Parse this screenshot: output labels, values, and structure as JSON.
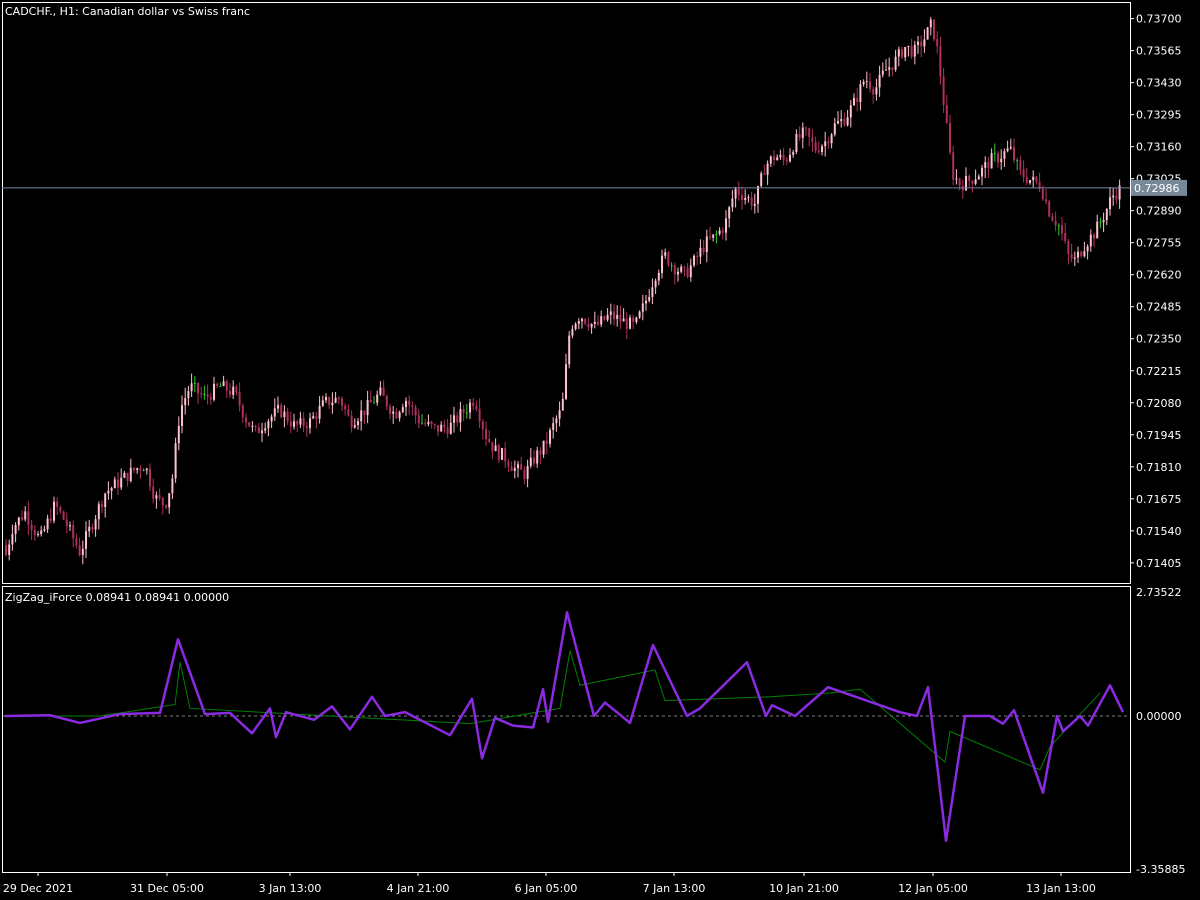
{
  "price_pane": {
    "title": "CADCHF., H1:  Canadian dollar vs Swiss franc",
    "y_ticks": [
      "0.73700",
      "0.73565",
      "0.73430",
      "0.73295",
      "0.73160",
      "0.73025",
      "0.72890",
      "0.72755",
      "0.72620",
      "0.72485",
      "0.72350",
      "0.72215",
      "0.72080",
      "0.71945",
      "0.71810",
      "0.71675",
      "0.71540",
      "0.71405"
    ],
    "current_price": "0.72986"
  },
  "indicator_pane": {
    "title": "ZigZag_iForce 0.08941 0.08941 0.00000",
    "y_ticks": [
      "2.73522",
      "0.00000",
      "-3.35885"
    ]
  },
  "x_ticks": [
    "29 Dec 2021",
    "31 Dec 05:00",
    "3 Jan 13:00",
    "4 Jan 21:00",
    "6 Jan 05:00",
    "7 Jan 13:00",
    "10 Jan 21:00",
    "12 Jan 05:00",
    "13 Jan 13:00"
  ],
  "colors": {
    "background": "#000000",
    "frame": "#ffffff",
    "bull_candle": "#ffc0cb",
    "bear_candle": "#b03060",
    "neutral_candle": "#32cd32",
    "zigzag": "#8a2be2",
    "force_line": "#008000",
    "zero_line": "#808080",
    "price_line": "#778899",
    "price_tag_bg": "#778899"
  },
  "chart_data": [
    {
      "type": "candlestick",
      "title": "CADCHF., H1:  Canadian dollar vs Swiss franc",
      "timeframe": "H1",
      "ylim": [
        0.7132,
        0.7377
      ],
      "close_path": [
        [
          0,
          0.7148
        ],
        [
          5,
          0.7142
        ],
        [
          12,
          0.7155
        ],
        [
          25,
          0.7162
        ],
        [
          40,
          0.715
        ],
        [
          55,
          0.7165
        ],
        [
          65,
          0.7158
        ],
        [
          80,
          0.7145
        ],
        [
          95,
          0.716
        ],
        [
          105,
          0.717
        ],
        [
          120,
          0.7175
        ],
        [
          135,
          0.718
        ],
        [
          145,
          0.7182
        ],
        [
          155,
          0.7168
        ],
        [
          165,
          0.7165
        ],
        [
          172,
          0.7175
        ],
        [
          180,
          0.7205
        ],
        [
          190,
          0.7215
        ],
        [
          205,
          0.721
        ],
        [
          220,
          0.7215
        ],
        [
          235,
          0.7212
        ],
        [
          245,
          0.7202
        ],
        [
          255,
          0.7195
        ],
        [
          265,
          0.72
        ],
        [
          280,
          0.7205
        ],
        [
          295,
          0.7198
        ],
        [
          310,
          0.72
        ],
        [
          325,
          0.7208
        ],
        [
          340,
          0.721
        ],
        [
          350,
          0.72
        ],
        [
          365,
          0.7205
        ],
        [
          380,
          0.7212
        ],
        [
          395,
          0.7203
        ],
        [
          405,
          0.721
        ],
        [
          420,
          0.72
        ],
        [
          435,
          0.7197
        ],
        [
          450,
          0.7198
        ],
        [
          465,
          0.7205
        ],
        [
          475,
          0.721
        ],
        [
          485,
          0.7195
        ],
        [
          495,
          0.7188
        ],
        [
          505,
          0.7185
        ],
        [
          515,
          0.718
        ],
        [
          525,
          0.7178
        ],
        [
          535,
          0.7185
        ],
        [
          545,
          0.719
        ],
        [
          555,
          0.72
        ],
        [
          562,
          0.7205
        ],
        [
          570,
          0.724
        ],
        [
          580,
          0.7245
        ],
        [
          595,
          0.724
        ],
        [
          610,
          0.7245
        ],
        [
          625,
          0.7242
        ],
        [
          635,
          0.724
        ],
        [
          645,
          0.725
        ],
        [
          655,
          0.7262
        ],
        [
          665,
          0.727
        ],
        [
          675,
          0.7265
        ],
        [
          685,
          0.7262
        ],
        [
          695,
          0.7268
        ],
        [
          705,
          0.7275
        ],
        [
          715,
          0.7278
        ],
        [
          725,
          0.7283
        ],
        [
          735,
          0.7298
        ],
        [
          745,
          0.7295
        ],
        [
          755,
          0.7292
        ],
        [
          765,
          0.7308
        ],
        [
          775,
          0.7312
        ],
        [
          785,
          0.731
        ],
        [
          795,
          0.7318
        ],
        [
          805,
          0.7322
        ],
        [
          815,
          0.7315
        ],
        [
          825,
          0.7318
        ],
        [
          835,
          0.7325
        ],
        [
          845,
          0.7328
        ],
        [
          855,
          0.7335
        ],
        [
          865,
          0.7345
        ],
        [
          875,
          0.734
        ],
        [
          885,
          0.7348
        ],
        [
          895,
          0.7352
        ],
        [
          905,
          0.7358
        ],
        [
          915,
          0.7356
        ],
        [
          925,
          0.7362
        ],
        [
          932,
          0.7368
        ],
        [
          938,
          0.7355
        ],
        [
          945,
          0.733
        ],
        [
          952,
          0.7305
        ],
        [
          960,
          0.73
        ],
        [
          970,
          0.7302
        ],
        [
          980,
          0.7305
        ],
        [
          990,
          0.731
        ],
        [
          1000,
          0.7312
        ],
        [
          1010,
          0.7315
        ],
        [
          1020,
          0.7305
        ],
        [
          1030,
          0.7302
        ],
        [
          1040,
          0.73
        ],
        [
          1050,
          0.7288
        ],
        [
          1060,
          0.7282
        ],
        [
          1068,
          0.727
        ],
        [
          1075,
          0.7268
        ],
        [
          1085,
          0.7275
        ],
        [
          1095,
          0.728
        ],
        [
          1105,
          0.7288
        ],
        [
          1112,
          0.7295
        ],
        [
          1120,
          0.7298
        ]
      ]
    },
    {
      "type": "line",
      "title": "ZigZag_iForce 0.08941 0.08941 0.00000",
      "ylim": [
        -3.35885,
        2.73522
      ],
      "series": [
        {
          "name": "ZigZag",
          "points": [
            [
              5,
              0.0
            ],
            [
              50,
              0.02
            ],
            [
              80,
              -0.18
            ],
            [
              120,
              0.05
            ],
            [
              160,
              0.08
            ],
            [
              178,
              2.0
            ],
            [
              205,
              0.05
            ],
            [
              230,
              0.08
            ],
            [
              252,
              -0.45
            ],
            [
              270,
              0.2
            ],
            [
              276,
              -0.55
            ],
            [
              286,
              0.1
            ],
            [
              314,
              -0.1
            ],
            [
              332,
              0.25
            ],
            [
              350,
              -0.35
            ],
            [
              372,
              0.5
            ],
            [
              385,
              0.0
            ],
            [
              405,
              0.1
            ],
            [
              450,
              -0.5
            ],
            [
              472,
              0.45
            ],
            [
              482,
              -1.1
            ],
            [
              495,
              -0.05
            ],
            [
              513,
              -0.25
            ],
            [
              533,
              -0.3
            ],
            [
              543,
              0.7
            ],
            [
              548,
              -0.15
            ],
            [
              567,
              2.7
            ],
            [
              594,
              0.0
            ],
            [
              605,
              0.35
            ],
            [
              630,
              -0.18
            ],
            [
              653,
              1.85
            ],
            [
              687,
              0.0
            ],
            [
              700,
              0.2
            ],
            [
              747,
              1.4
            ],
            [
              766,
              0.0
            ],
            [
              772,
              0.28
            ],
            [
              795,
              0.0
            ],
            [
              828,
              0.75
            ],
            [
              900,
              0.1
            ],
            [
              917,
              0.0
            ],
            [
              928,
              0.75
            ],
            [
              946,
              -3.25
            ],
            [
              965,
              0.0
            ],
            [
              990,
              0.0
            ],
            [
              1003,
              -0.2
            ],
            [
              1014,
              0.15
            ],
            [
              1043,
              -2.0
            ],
            [
              1057,
              0.0
            ],
            [
              1063,
              -0.4
            ],
            [
              1080,
              0.0
            ],
            [
              1088,
              -0.25
            ],
            [
              1110,
              0.8
            ],
            [
              1123,
              0.1
            ]
          ]
        },
        {
          "name": "iForce",
          "points": [
            [
              5,
              0.0
            ],
            [
              100,
              0.0
            ],
            [
              175,
              0.3
            ],
            [
              180,
              1.4
            ],
            [
              190,
              0.2
            ],
            [
              330,
              0.0
            ],
            [
              470,
              -0.2
            ],
            [
              560,
              0.2
            ],
            [
              570,
              1.7
            ],
            [
              580,
              0.8
            ],
            [
              655,
              1.2
            ],
            [
              665,
              0.4
            ],
            [
              770,
              0.5
            ],
            [
              830,
              0.6
            ],
            [
              860,
              0.7
            ],
            [
              945,
              -1.2
            ],
            [
              950,
              -0.4
            ],
            [
              1040,
              -1.4
            ],
            [
              1050,
              -0.8
            ],
            [
              1100,
              0.6
            ]
          ]
        }
      ]
    }
  ]
}
